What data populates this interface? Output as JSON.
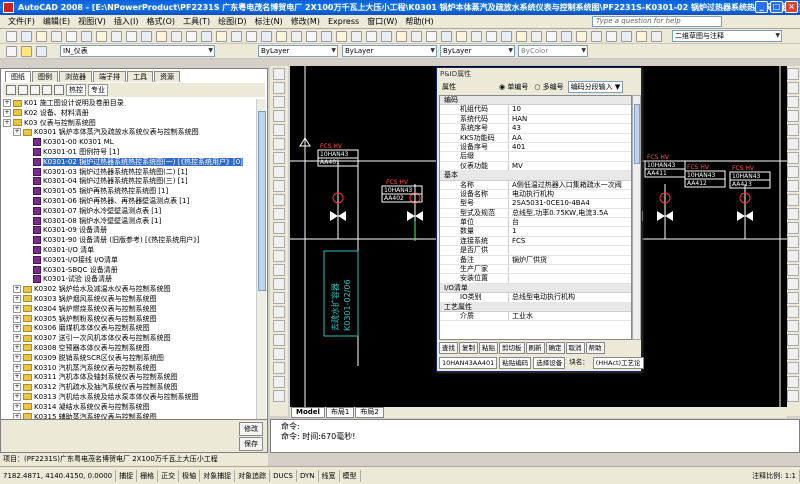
{
  "window": {
    "title": "AutoCAD 2008 - [E:\\NPowerProduct\\PF2231S 广东粤电茂名博贺电厂 2X100万千瓦上大压小工程\\K0301 锅炉本体蒸汽及疏放水系统仪表与控制系统图\\PF2231S-K0301-02 锅炉过热器系统热控系统图(一).dwg]"
  },
  "menu": [
    "文件(F)",
    "编辑(E)",
    "视图(V)",
    "插入(I)",
    "格式(O)",
    "工具(T)",
    "绘图(D)",
    "标注(N)",
    "修改(M)",
    "Express",
    "窗口(W)",
    "帮助(H)"
  ],
  "help_placeholder": "Type a question for help",
  "toolbar": {
    "layer": "IN_仪表",
    "workspace": "二维草图与注释",
    "bylayer1": "ByLayer",
    "bylayer2": "ByLayer",
    "bylayer3": "ByLayer",
    "bycolor": "ByColor"
  },
  "left": {
    "tabs": [
      "图纸",
      "图例",
      "浏览器",
      "端子排",
      "工具",
      "资源"
    ],
    "toolbar_labels": [
      "热控",
      "专业"
    ],
    "tree": [
      {
        "text": "K01 施工图设计说明及卷册目录",
        "lv": 0,
        "t": "f"
      },
      {
        "text": "K02 设备、材料清册",
        "lv": 0,
        "t": "f"
      },
      {
        "text": "K03 仪表与控制系统图",
        "lv": 0,
        "t": "f"
      },
      {
        "text": "K0301 锅炉本体蒸汽及疏放水系统仪表与控制系统图",
        "lv": 1,
        "t": "f"
      },
      {
        "text": "K0301-00 K0301 ML",
        "lv": 2,
        "t": "m"
      },
      {
        "text": "K0301-01 图例符号 [1]",
        "lv": 2,
        "t": "m"
      },
      {
        "text": "K0301-02 锅炉过热器系统热控系统图(一) [《热控系统用户》[0]",
        "lv": 2,
        "t": "m",
        "sel": true
      },
      {
        "text": "K0301-03 锅炉过热器系统热控系统图(二) [1]",
        "lv": 2,
        "t": "m"
      },
      {
        "text": "K0301-04 锅炉过热器系统热控系统图(三) [1]",
        "lv": 2,
        "t": "m"
      },
      {
        "text": "K0301-05 锅炉再热系统热控系统图 [1]",
        "lv": 2,
        "t": "m"
      },
      {
        "text": "K0301-06 锅炉再热器、再热器壁温测点表 [1]",
        "lv": 2,
        "t": "m"
      },
      {
        "text": "K0301-07 锅炉水冷壁壁温测点表 [1]",
        "lv": 2,
        "t": "m"
      },
      {
        "text": "K0301-08 锅炉水冷壁壁温测点表 [1]",
        "lv": 2,
        "t": "m"
      },
      {
        "text": "K0301-09 设备清册",
        "lv": 2,
        "t": "m"
      },
      {
        "text": "K0301-90 设备清册 (旧版参考) [《热控系统用户》]",
        "lv": 2,
        "t": "m"
      },
      {
        "text": "K0301-I/O 清单",
        "lv": 2,
        "t": "m"
      },
      {
        "text": "K0301-I/O接线 I/O清单",
        "lv": 2,
        "t": "m"
      },
      {
        "text": "K0301-SBQC 设备清册",
        "lv": 2,
        "t": "m"
      },
      {
        "text": "K0301-试验 设备清册",
        "lv": 2,
        "t": "m"
      },
      {
        "text": "K0302 锅炉给水及减温水仪表与控制系统图",
        "lv": 1,
        "t": "f"
      },
      {
        "text": "K0303 锅炉烟风系统仪表与控制系统图",
        "lv": 1,
        "t": "f"
      },
      {
        "text": "K0304 锅炉燃烧系统仪表与控制系统图",
        "lv": 1,
        "t": "f"
      },
      {
        "text": "K0305 锅炉制粉系统仪表与控制系统图",
        "lv": 1,
        "t": "f"
      },
      {
        "text": "K0306 磨煤机本体仪表与控制系统图",
        "lv": 1,
        "t": "f"
      },
      {
        "text": "K0307 送引一次风机本体仪表与控制系统图",
        "lv": 1,
        "t": "f"
      },
      {
        "text": "K0308 空预器本体仪表与控制系统图",
        "lv": 1,
        "t": "f"
      },
      {
        "text": "K0309 脱销系统SCR区仪表与控制系统图",
        "lv": 1,
        "t": "f"
      },
      {
        "text": "K0310 汽机蒸汽系统仪表与控制系统图",
        "lv": 1,
        "t": "f"
      },
      {
        "text": "K0311 汽机本体及轴封系统仪表与控制系统图",
        "lv": 1,
        "t": "f"
      },
      {
        "text": "K0312 汽机疏水及抽汽系统仪表与控制系统图",
        "lv": 1,
        "t": "f"
      },
      {
        "text": "K0313 汽机给水系统及给水泵本体仪表与控制系统图",
        "lv": 1,
        "t": "f"
      },
      {
        "text": "K0314 凝结水系统仪表与控制系统图",
        "lv": 1,
        "t": "f"
      },
      {
        "text": "K0315 辅助蒸汽系统仪表与控制系统图",
        "lv": 1,
        "t": "f"
      },
      {
        "text": "K0316 汽机润滑油系统仪表与控制系统图",
        "lv": 1,
        "t": "f"
      }
    ],
    "bottom_buttons": [
      "修改",
      "保存"
    ],
    "path": "项目：(PF2231S)广东粤电茂名博贺电厂 2X100万千瓦上大压小工程"
  },
  "dialog": {
    "title": "P&ID属性",
    "header_label": "属性",
    "radio1": "单编号",
    "radio2": "多编号",
    "dropdown": "编码分段输入",
    "sections": [
      {
        "name": "编码",
        "rows": [
          [
            "机组代码",
            "10"
          ],
          [
            "系统代码",
            "HAN"
          ],
          [
            "系统序号",
            "43"
          ],
          [
            "KKS功能码",
            "AA"
          ],
          [
            "设备序号",
            "401"
          ],
          [
            "后缀",
            ""
          ],
          [
            "仪表功能",
            "MV"
          ]
        ]
      },
      {
        "name": "基本",
        "rows": [
          [
            "名称",
            "A侧低温过热器入口集箱疏水一次阀"
          ],
          [
            "设备名称",
            "电动执行机构"
          ],
          [
            "型号",
            "2SA5031-0CE10-4BA4"
          ],
          [
            "型式及规范",
            "总线型,功率0.75KW,电流3.5A"
          ],
          [
            "单位",
            "台"
          ],
          [
            "数量",
            "1"
          ],
          [
            "连接系统",
            "FCS"
          ],
          [
            "是否厂供",
            ""
          ],
          [
            "备注",
            "锅炉厂供货"
          ],
          [
            "生产厂家",
            ""
          ],
          [
            "安装位置",
            ""
          ]
        ]
      },
      {
        "name": "I/O清单",
        "rows": [
          [
            "IO类别",
            "总线型电动执行机构"
          ]
        ]
      },
      {
        "name": "工艺属性",
        "rows": [
          [
            "介质",
            "工业水"
          ]
        ]
      }
    ],
    "buttons": [
      "查找",
      "复制",
      "粘贴",
      "剪切板",
      "刷新",
      "确定",
      "取消",
      "帮助"
    ],
    "footer": {
      "code": "10HAN43AA401",
      "b1": "粘贴编码",
      "b2": "选择设备",
      "b3": "块名：",
      "b4": "(HHAct)工艺论"
    }
  },
  "canvas": {
    "labels": [
      "FCS HV",
      "10HAN43",
      "AA401",
      "FCS HV",
      "10HAN43",
      "AA402",
      "FCS HV",
      "10HAN43",
      "AA411",
      "FCS HV",
      "10HAN43",
      "AA412",
      "FCS HV",
      "10HAN43",
      "AA413"
    ],
    "vertical_text": "去疏水扩容器",
    "vertical_code": "K0301-02/06"
  },
  "model_tabs": [
    "Model",
    "布局1",
    "布局2"
  ],
  "command": {
    "line1": "命令:",
    "line2": "命令: 时间:670毫秒!"
  },
  "status": {
    "coords": "7182.4871, 4140.4150, 0.0000",
    "items": [
      "捕捉",
      "栅格",
      "正交",
      "极轴",
      "对象捕捉",
      "对象追踪",
      "DUCS",
      "DYN",
      "线宽",
      "模型"
    ],
    "scale": "注释比例: 1:1"
  }
}
